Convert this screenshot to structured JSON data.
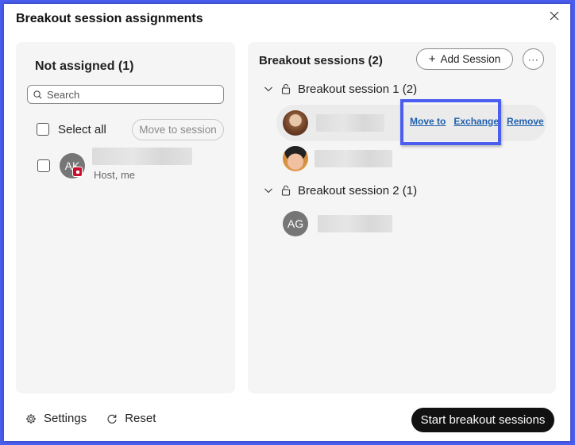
{
  "dialog": {
    "title": "Breakout session assignments",
    "close_icon": "close-icon"
  },
  "not_assigned": {
    "heading": "Not assigned (1)",
    "search": {
      "placeholder": "Search",
      "value": "",
      "icon": "search-icon"
    },
    "select_all_label": "Select all",
    "select_all_checked": false,
    "move_to_session_label": "Move to session",
    "participants": [
      {
        "initials": "AK",
        "name_redacted": true,
        "role": "Host, me",
        "badge_icon": "host-badge-icon",
        "checked": false
      }
    ]
  },
  "sessions_panel": {
    "heading": "Breakout sessions  (2)",
    "add_session_label": "Add Session",
    "add_session_icon": "plus-icon",
    "more_label": "···",
    "sessions": [
      {
        "label": "Breakout session 1 (2)",
        "expanded": true,
        "locked_icon": "lock-icon",
        "members": [
          {
            "avatar_type": "photo",
            "name_redacted": true,
            "hovered": true,
            "actions": [
              "Move to",
              "Exchange",
              "Remove"
            ]
          },
          {
            "avatar_type": "photo",
            "name_redacted": true,
            "hovered": false
          }
        ]
      },
      {
        "label": "Breakout session 2 (1)",
        "expanded": true,
        "locked_icon": "lock-icon",
        "members": [
          {
            "avatar_type": "initials",
            "initials": "AG",
            "name_redacted": true,
            "hovered": false
          }
        ]
      }
    ]
  },
  "footer": {
    "settings_label": "Settings",
    "reset_label": "Reset",
    "start_label": "Start breakout sessions"
  },
  "colors": {
    "highlight": "#4a5ef0",
    "link": "#1f5fad",
    "host_badge": "#c8102e",
    "primary_button": "#111111"
  }
}
